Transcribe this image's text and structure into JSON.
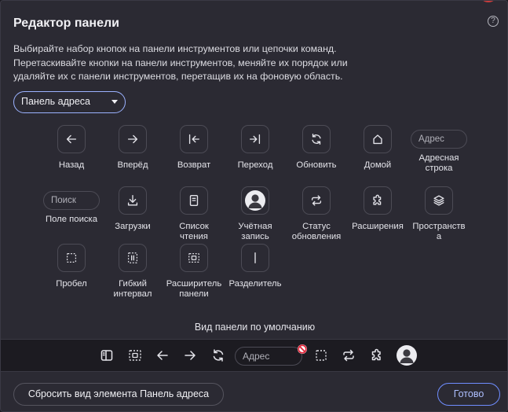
{
  "dialog": {
    "title": "Редактор панели",
    "help_glyph": "?",
    "description_lines": [
      "Выбирайте набор кнопок на панели инструментов или цепочки команд.",
      "Перетаскивайте кнопки на панели инструментов, меняйте их порядок или",
      "удаляйте их с панели инструментов, перетащив их на фоновую область."
    ],
    "select_value": "Панель адреса"
  },
  "palette": [
    {
      "id": "back",
      "icon": "arrow-left-icon",
      "label": [
        "Назад"
      ]
    },
    {
      "id": "forward",
      "icon": "arrow-right-icon",
      "label": [
        "Вперёд"
      ]
    },
    {
      "id": "return",
      "icon": "arrow-to-start-icon",
      "label": [
        "Возврат"
      ]
    },
    {
      "id": "goto",
      "icon": "arrow-to-end-icon",
      "label": [
        "Переход"
      ]
    },
    {
      "id": "reload",
      "icon": "reload-icon",
      "label": [
        "Обновить"
      ]
    },
    {
      "id": "home",
      "icon": "home-icon",
      "label": [
        "Домой"
      ]
    },
    {
      "id": "address",
      "icon": "address-field",
      "field_text": "Адрес",
      "label": [
        "Адресная",
        "строка"
      ]
    },
    {
      "id": "search",
      "icon": "search-field",
      "field_text": "Поиск",
      "label": [
        "Поле поиска"
      ]
    },
    {
      "id": "downloads",
      "icon": "download-icon",
      "label": [
        "Загрузки"
      ]
    },
    {
      "id": "reading-list",
      "icon": "reading-list-icon",
      "label": [
        "Список",
        "чтения"
      ]
    },
    {
      "id": "account",
      "icon": "avatar-icon",
      "label": [
        "Учётная",
        "запись"
      ]
    },
    {
      "id": "sync",
      "icon": "sync-icon",
      "label": [
        "Статус",
        "обновления"
      ]
    },
    {
      "id": "extensions",
      "icon": "puzzle-icon",
      "label": [
        "Расширения"
      ]
    },
    {
      "id": "spaces",
      "icon": "layers-icon",
      "label": [
        "Пространств",
        "а"
      ]
    },
    {
      "id": "space",
      "icon": "dashed-square-icon",
      "label": [
        "Пробел"
      ]
    },
    {
      "id": "flex-space",
      "icon": "flexible-space-icon",
      "label": [
        "Гибкий",
        "интервал"
      ]
    },
    {
      "id": "panel-expander",
      "icon": "panel-expander-icon",
      "label": [
        "Расширитель",
        "панели"
      ]
    },
    {
      "id": "divider",
      "icon": "divider-icon",
      "label": [
        "Разделитель"
      ]
    }
  ],
  "default_bar": {
    "heading": "Вид панели по умолчанию",
    "address_placeholder": "Адрес",
    "items": [
      "panel-toggle-icon",
      "panel-expander-icon",
      "arrow-left-icon",
      "arrow-right-icon",
      "reload-icon",
      "address-field",
      "dashed-square-icon",
      "sync-icon",
      "puzzle-icon",
      "avatar-icon"
    ]
  },
  "footer": {
    "reset_label": "Сбросить вид элемента Панель адреса",
    "done_label": "Готово"
  },
  "colors": {
    "background": "#2b2a33",
    "bar_background": "#1c1b21",
    "accent": "#9bb2ff",
    "done_text": "#aebfff",
    "text": "#e4e4ea",
    "no_sign": "#e0283c"
  }
}
